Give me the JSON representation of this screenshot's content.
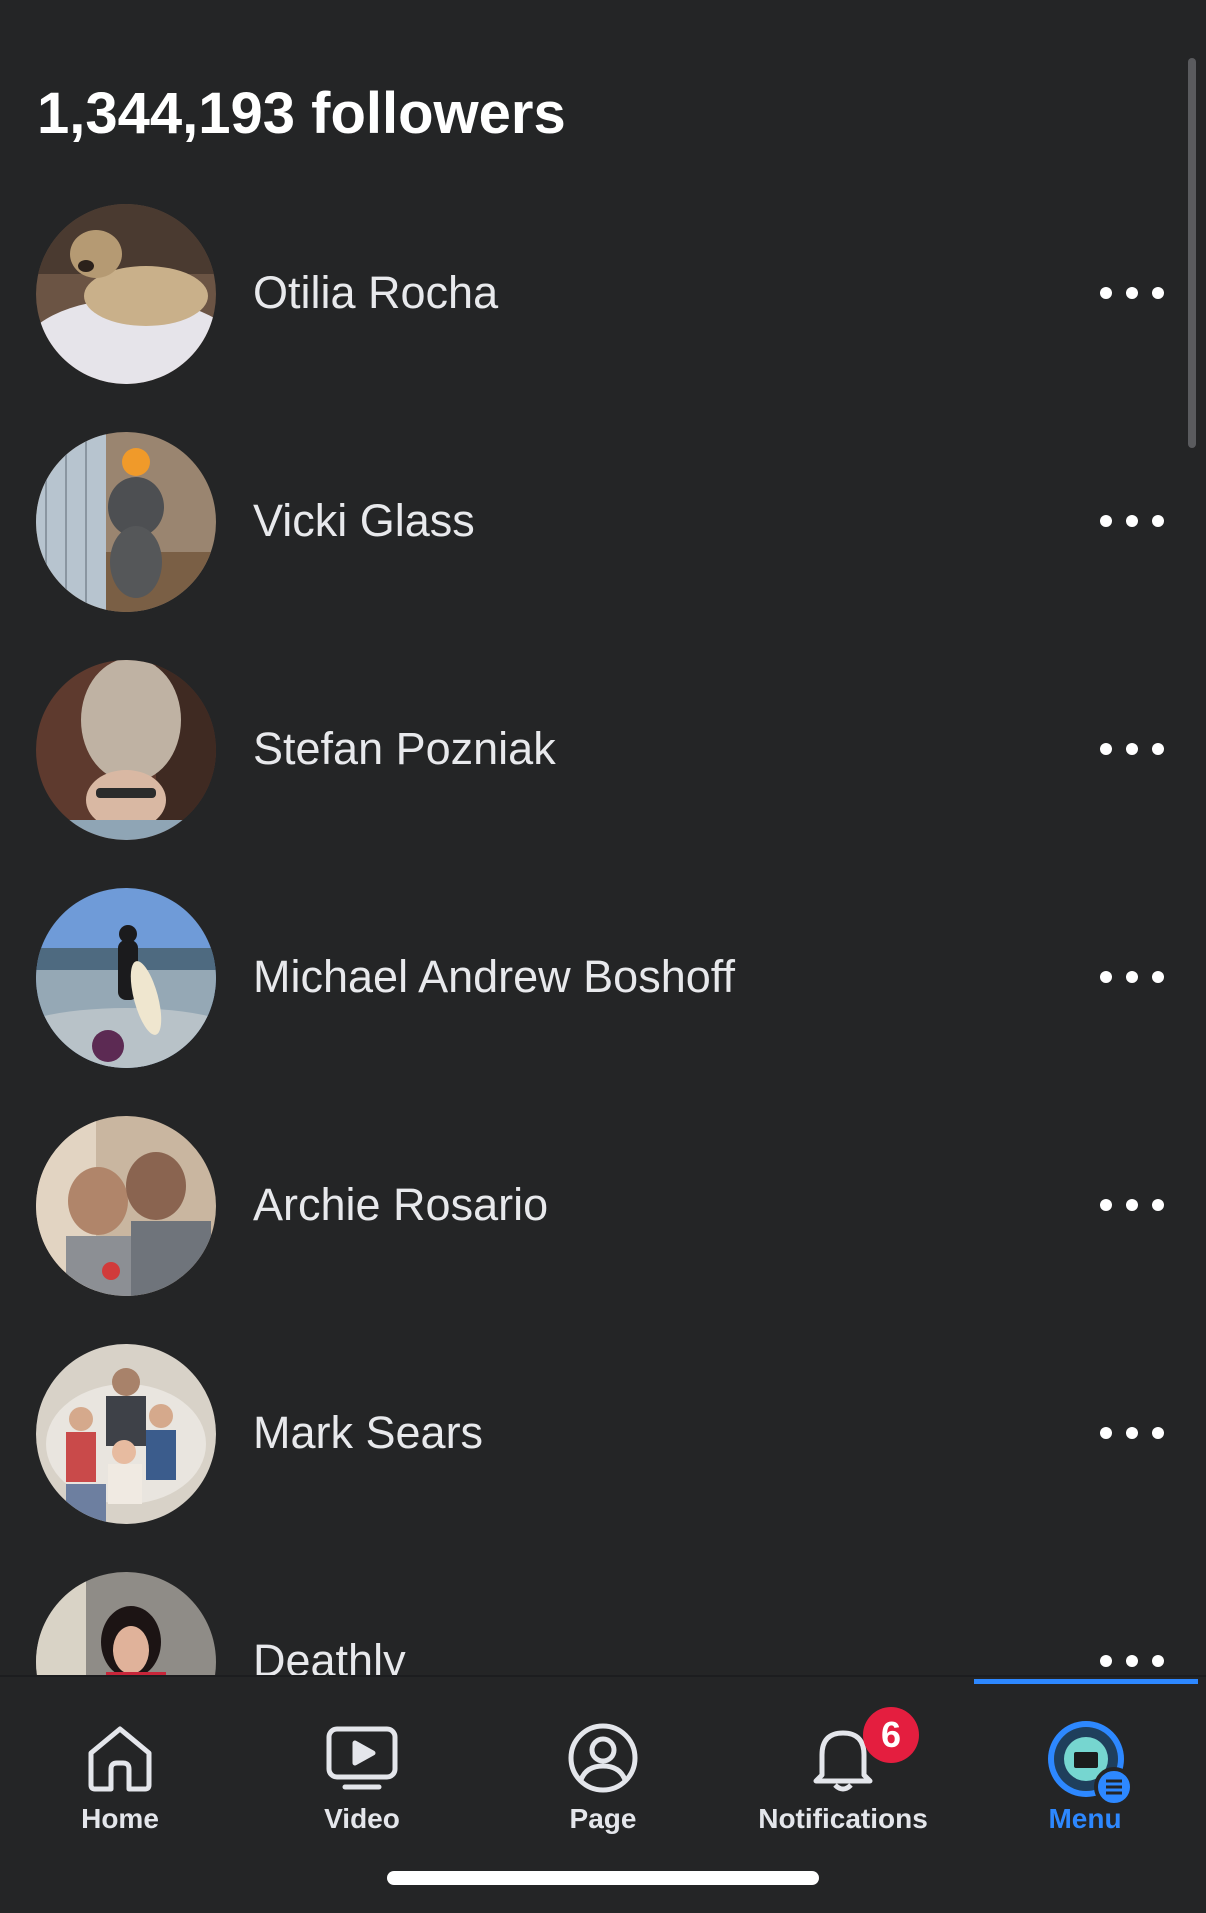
{
  "header": {
    "title": "1,344,193 followers"
  },
  "followers": [
    {
      "name": "Otilia Rocha",
      "avatar": "dog-photo"
    },
    {
      "name": "Vicki Glass",
      "avatar": "dog-photo"
    },
    {
      "name": "Stefan Pozniak",
      "avatar": "person-photo"
    },
    {
      "name": "Michael Andrew Boshoff",
      "avatar": "surfer-beach-photo"
    },
    {
      "name": "Archie Rosario",
      "avatar": "couple-photo"
    },
    {
      "name": "Mark Sears",
      "avatar": "family-photo"
    },
    {
      "name": "Deathly",
      "avatar": "person-photo"
    }
  ],
  "more_icon": "more-horizontal-icon",
  "tab_bar": {
    "active": "Menu",
    "notifications_badge": "6",
    "tabs": [
      {
        "label": "Home",
        "icon": "home-icon"
      },
      {
        "label": "Video",
        "icon": "video-icon"
      },
      {
        "label": "Page",
        "icon": "page-profile-icon"
      },
      {
        "label": "Notifications",
        "icon": "bell-icon"
      },
      {
        "label": "Menu",
        "icon": "page-avatar-menu-icon"
      }
    ]
  },
  "colors": {
    "background": "#242526",
    "text": "#e4e6eb",
    "accent": "#2d88ff",
    "badge": "#e41e3f"
  }
}
